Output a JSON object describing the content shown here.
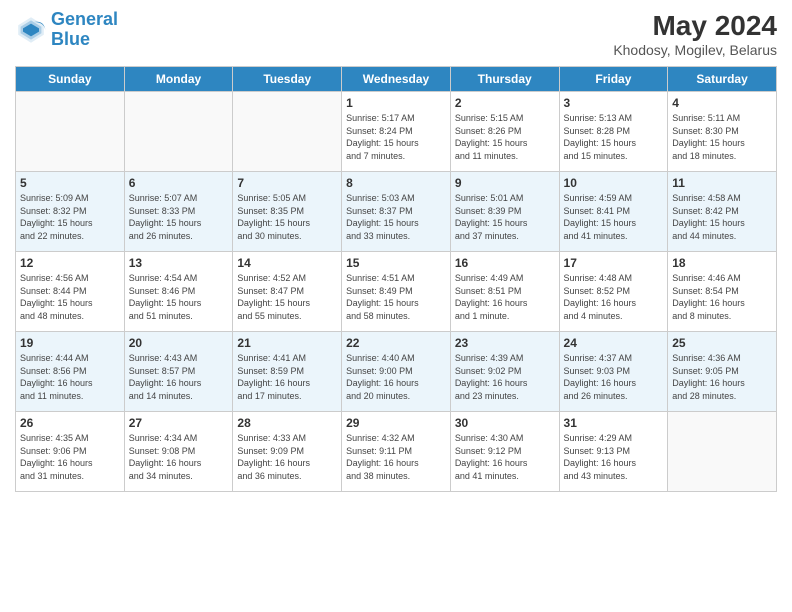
{
  "header": {
    "logo_line1": "General",
    "logo_line2": "Blue",
    "month_year": "May 2024",
    "location": "Khodosy, Mogilev, Belarus"
  },
  "days_of_week": [
    "Sunday",
    "Monday",
    "Tuesday",
    "Wednesday",
    "Thursday",
    "Friday",
    "Saturday"
  ],
  "weeks": [
    [
      {
        "day": "",
        "info": ""
      },
      {
        "day": "",
        "info": ""
      },
      {
        "day": "",
        "info": ""
      },
      {
        "day": "1",
        "info": "Sunrise: 5:17 AM\nSunset: 8:24 PM\nDaylight: 15 hours\nand 7 minutes."
      },
      {
        "day": "2",
        "info": "Sunrise: 5:15 AM\nSunset: 8:26 PM\nDaylight: 15 hours\nand 11 minutes."
      },
      {
        "day": "3",
        "info": "Sunrise: 5:13 AM\nSunset: 8:28 PM\nDaylight: 15 hours\nand 15 minutes."
      },
      {
        "day": "4",
        "info": "Sunrise: 5:11 AM\nSunset: 8:30 PM\nDaylight: 15 hours\nand 18 minutes."
      }
    ],
    [
      {
        "day": "5",
        "info": "Sunrise: 5:09 AM\nSunset: 8:32 PM\nDaylight: 15 hours\nand 22 minutes."
      },
      {
        "day": "6",
        "info": "Sunrise: 5:07 AM\nSunset: 8:33 PM\nDaylight: 15 hours\nand 26 minutes."
      },
      {
        "day": "7",
        "info": "Sunrise: 5:05 AM\nSunset: 8:35 PM\nDaylight: 15 hours\nand 30 minutes."
      },
      {
        "day": "8",
        "info": "Sunrise: 5:03 AM\nSunset: 8:37 PM\nDaylight: 15 hours\nand 33 minutes."
      },
      {
        "day": "9",
        "info": "Sunrise: 5:01 AM\nSunset: 8:39 PM\nDaylight: 15 hours\nand 37 minutes."
      },
      {
        "day": "10",
        "info": "Sunrise: 4:59 AM\nSunset: 8:41 PM\nDaylight: 15 hours\nand 41 minutes."
      },
      {
        "day": "11",
        "info": "Sunrise: 4:58 AM\nSunset: 8:42 PM\nDaylight: 15 hours\nand 44 minutes."
      }
    ],
    [
      {
        "day": "12",
        "info": "Sunrise: 4:56 AM\nSunset: 8:44 PM\nDaylight: 15 hours\nand 48 minutes."
      },
      {
        "day": "13",
        "info": "Sunrise: 4:54 AM\nSunset: 8:46 PM\nDaylight: 15 hours\nand 51 minutes."
      },
      {
        "day": "14",
        "info": "Sunrise: 4:52 AM\nSunset: 8:47 PM\nDaylight: 15 hours\nand 55 minutes."
      },
      {
        "day": "15",
        "info": "Sunrise: 4:51 AM\nSunset: 8:49 PM\nDaylight: 15 hours\nand 58 minutes."
      },
      {
        "day": "16",
        "info": "Sunrise: 4:49 AM\nSunset: 8:51 PM\nDaylight: 16 hours\nand 1 minute."
      },
      {
        "day": "17",
        "info": "Sunrise: 4:48 AM\nSunset: 8:52 PM\nDaylight: 16 hours\nand 4 minutes."
      },
      {
        "day": "18",
        "info": "Sunrise: 4:46 AM\nSunset: 8:54 PM\nDaylight: 16 hours\nand 8 minutes."
      }
    ],
    [
      {
        "day": "19",
        "info": "Sunrise: 4:44 AM\nSunset: 8:56 PM\nDaylight: 16 hours\nand 11 minutes."
      },
      {
        "day": "20",
        "info": "Sunrise: 4:43 AM\nSunset: 8:57 PM\nDaylight: 16 hours\nand 14 minutes."
      },
      {
        "day": "21",
        "info": "Sunrise: 4:41 AM\nSunset: 8:59 PM\nDaylight: 16 hours\nand 17 minutes."
      },
      {
        "day": "22",
        "info": "Sunrise: 4:40 AM\nSunset: 9:00 PM\nDaylight: 16 hours\nand 20 minutes."
      },
      {
        "day": "23",
        "info": "Sunrise: 4:39 AM\nSunset: 9:02 PM\nDaylight: 16 hours\nand 23 minutes."
      },
      {
        "day": "24",
        "info": "Sunrise: 4:37 AM\nSunset: 9:03 PM\nDaylight: 16 hours\nand 26 minutes."
      },
      {
        "day": "25",
        "info": "Sunrise: 4:36 AM\nSunset: 9:05 PM\nDaylight: 16 hours\nand 28 minutes."
      }
    ],
    [
      {
        "day": "26",
        "info": "Sunrise: 4:35 AM\nSunset: 9:06 PM\nDaylight: 16 hours\nand 31 minutes."
      },
      {
        "day": "27",
        "info": "Sunrise: 4:34 AM\nSunset: 9:08 PM\nDaylight: 16 hours\nand 34 minutes."
      },
      {
        "day": "28",
        "info": "Sunrise: 4:33 AM\nSunset: 9:09 PM\nDaylight: 16 hours\nand 36 minutes."
      },
      {
        "day": "29",
        "info": "Sunrise: 4:32 AM\nSunset: 9:11 PM\nDaylight: 16 hours\nand 38 minutes."
      },
      {
        "day": "30",
        "info": "Sunrise: 4:30 AM\nSunset: 9:12 PM\nDaylight: 16 hours\nand 41 minutes."
      },
      {
        "day": "31",
        "info": "Sunrise: 4:29 AM\nSunset: 9:13 PM\nDaylight: 16 hours\nand 43 minutes."
      },
      {
        "day": "",
        "info": ""
      }
    ]
  ]
}
